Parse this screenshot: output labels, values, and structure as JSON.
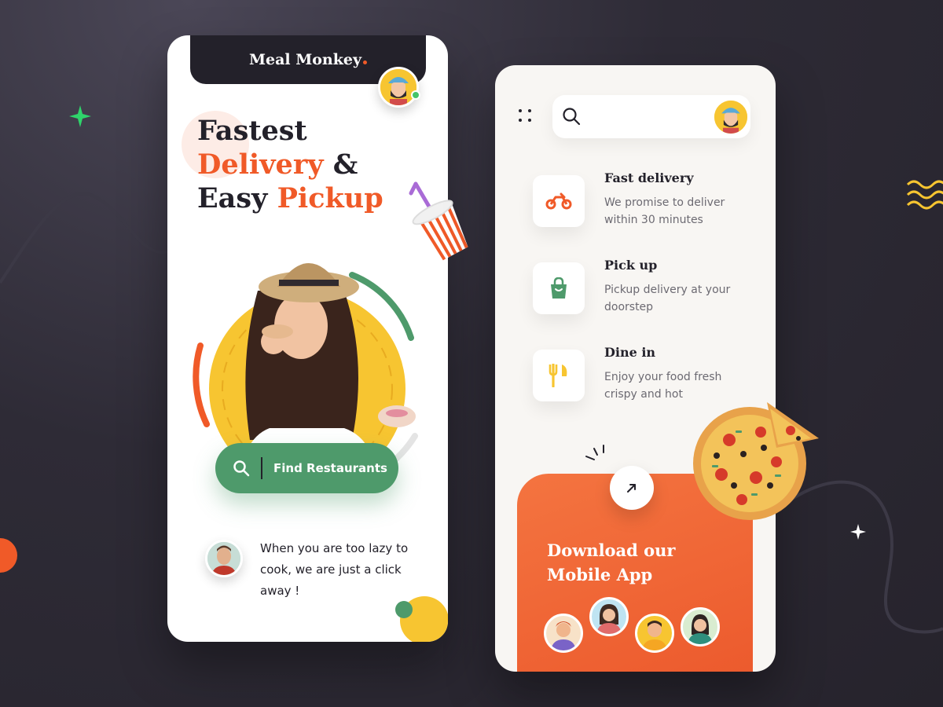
{
  "colors": {
    "accent_orange": "#f05a28",
    "accent_green": "#4e9a6b",
    "accent_yellow": "#f7c531",
    "dark": "#23212a",
    "background": "#2e2b36"
  },
  "screen_home": {
    "brand": "Meal Monkey",
    "hero_line1": "Fastest",
    "hero_line2_accent": "Delivery",
    "hero_line2_rest": " &",
    "hero_line3_plain": "Easy ",
    "hero_line3_accent": "Pickup",
    "find_button_label": "Find Restaurants",
    "tagline": "When you are too lazy to cook, we are just a click away !"
  },
  "screen_features": {
    "search_placeholder": "",
    "features": [
      {
        "icon": "scooter-icon",
        "title": "Fast delivery",
        "description": "We promise to deliver within 30 minutes"
      },
      {
        "icon": "shopping-bag-icon",
        "title": "Pick up",
        "description": "Pickup delivery at your doorstep"
      },
      {
        "icon": "fork-knife-icon",
        "title": "Dine in",
        "description": "Enjoy your food fresh crispy and hot"
      }
    ],
    "download_title": "Download our Mobile App"
  }
}
